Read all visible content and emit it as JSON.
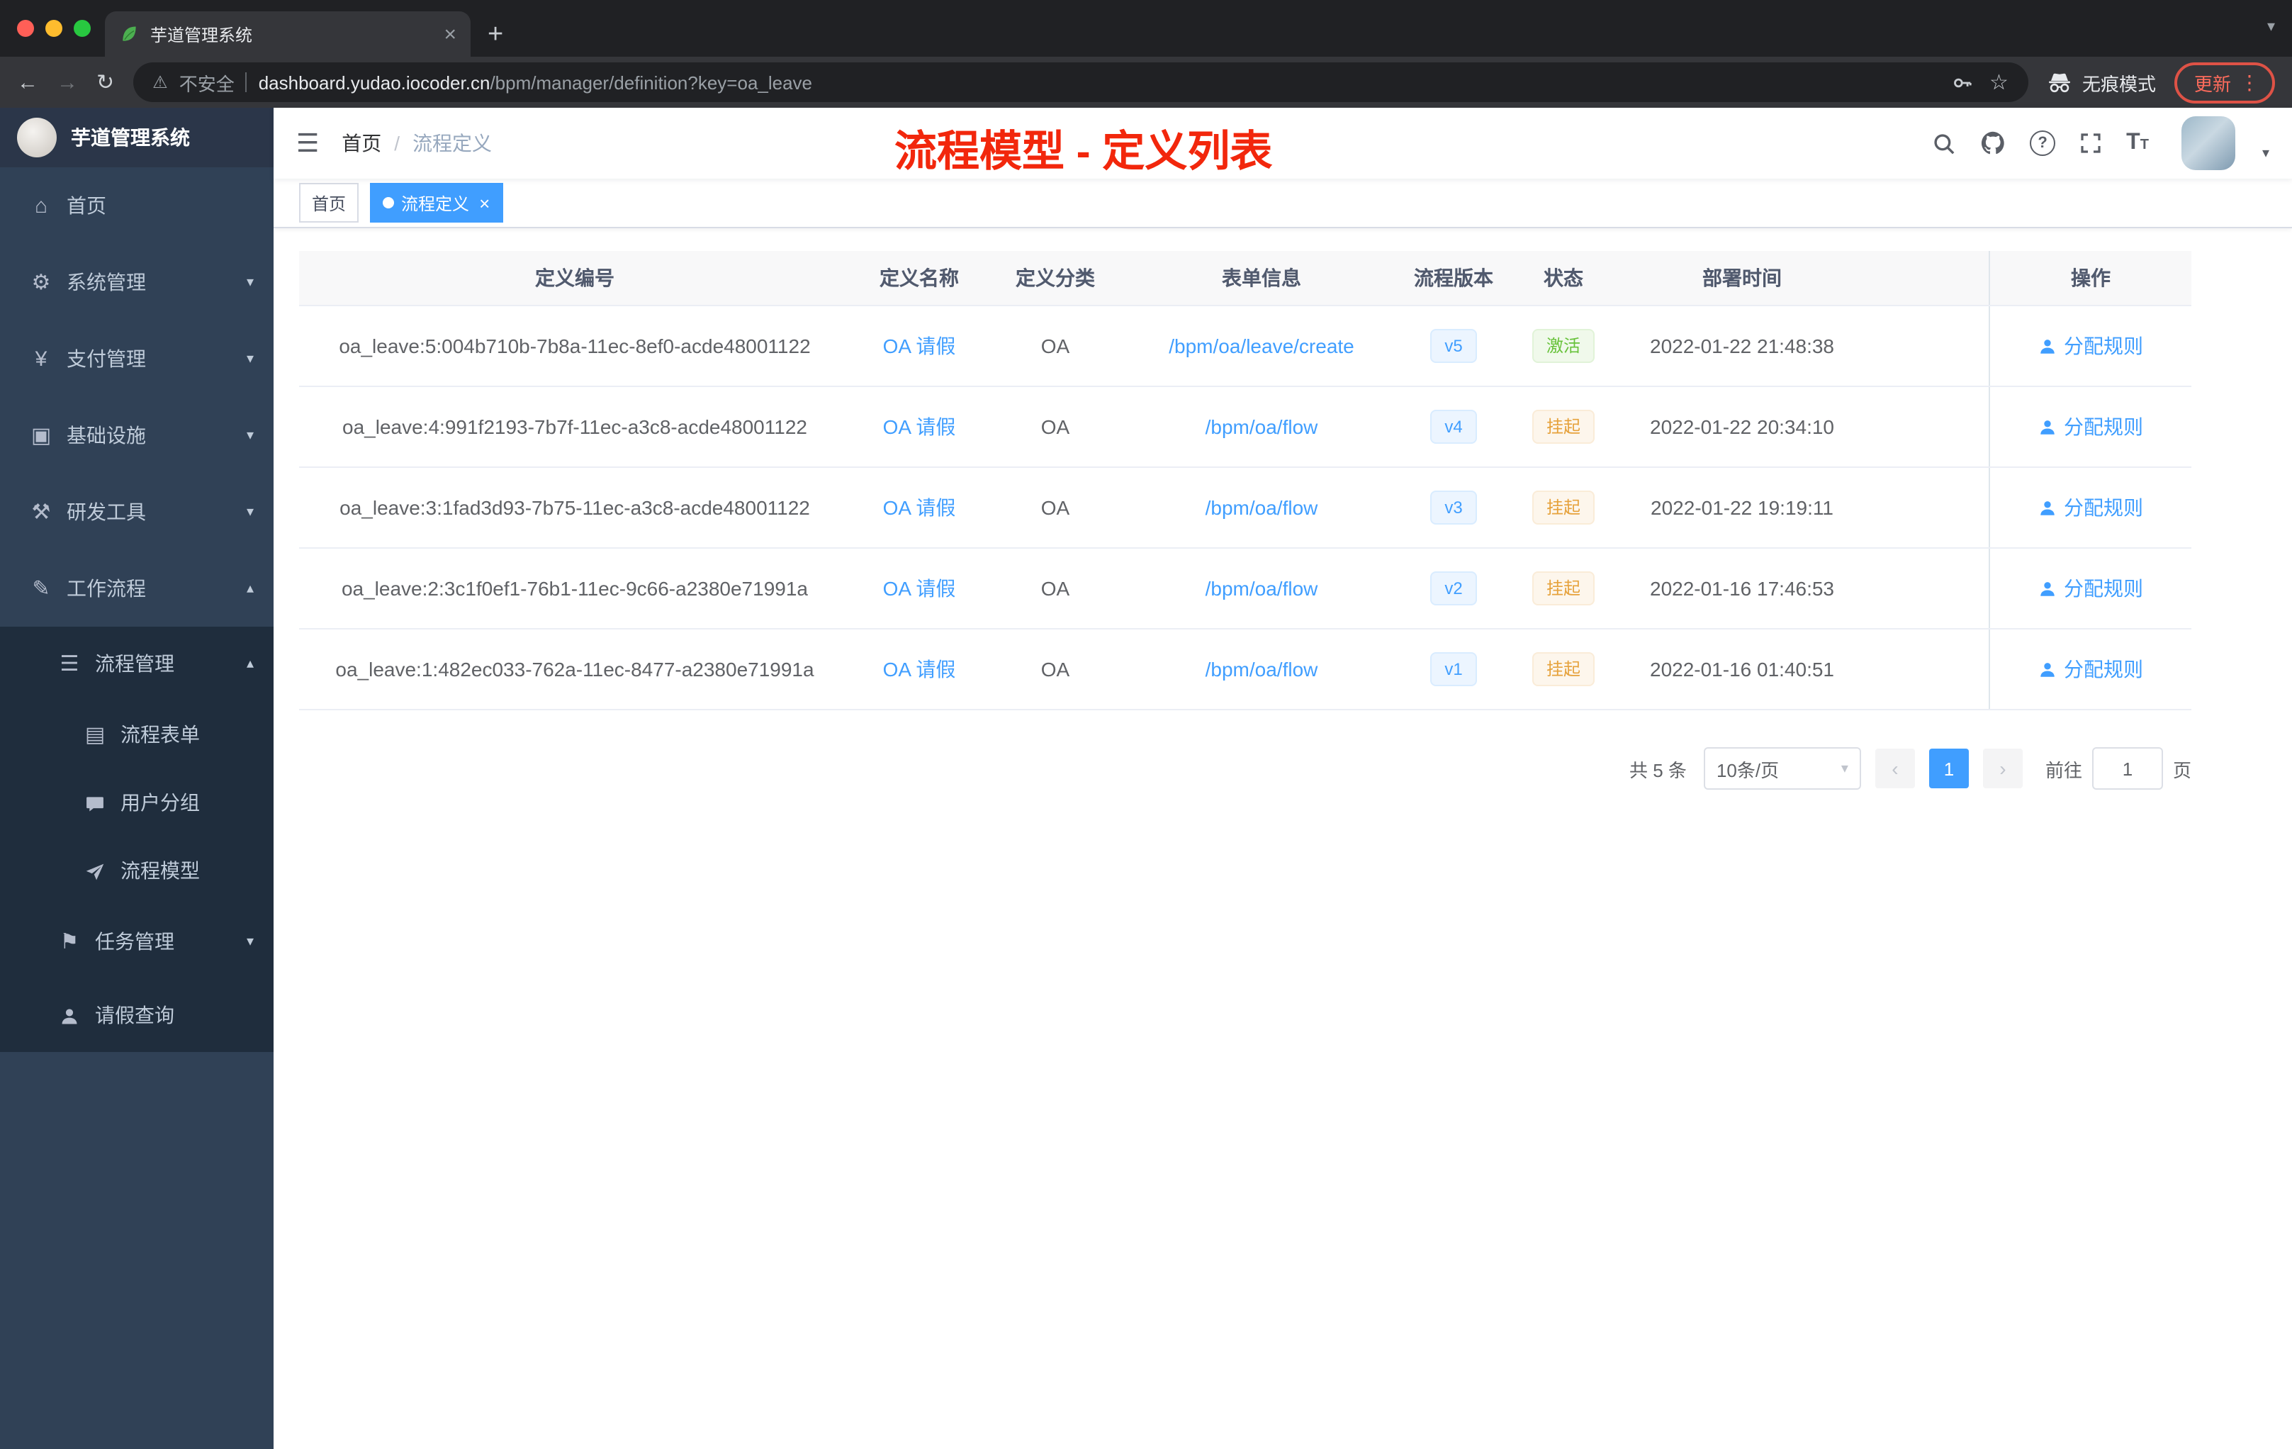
{
  "browser": {
    "tab_title": "芋道管理系统",
    "security_label": "不安全",
    "url_host": "dashboard.yudao.iocoder.cn",
    "url_path": "/bpm/manager/definition?key=oa_leave",
    "incognito_label": "无痕模式",
    "update_label": "更新"
  },
  "sidebar": {
    "logo_title": "芋道管理系统",
    "items": [
      {
        "label": "首页"
      },
      {
        "label": "系统管理"
      },
      {
        "label": "支付管理"
      },
      {
        "label": "基础设施"
      },
      {
        "label": "研发工具"
      },
      {
        "label": "工作流程"
      },
      {
        "label": "流程管理"
      },
      {
        "label": "流程表单"
      },
      {
        "label": "用户分组"
      },
      {
        "label": "流程模型"
      },
      {
        "label": "任务管理"
      },
      {
        "label": "请假查询"
      }
    ]
  },
  "header": {
    "breadcrumb_home": "首页",
    "breadcrumb_sep": "/",
    "breadcrumb_current": "流程定义",
    "annotation": "流程模型 - 定义列表"
  },
  "tags": {
    "home": "首页",
    "active": "流程定义"
  },
  "table": {
    "columns": [
      "定义编号",
      "定义名称",
      "定义分类",
      "表单信息",
      "流程版本",
      "状态",
      "部署时间",
      "操作"
    ],
    "rows": [
      {
        "id": "oa_leave:5:004b710b-7b8a-11ec-8ef0-acde48001122",
        "name": "OA 请假",
        "category": "OA",
        "form": "/bpm/oa/leave/create",
        "version": "v5",
        "status": "激活",
        "status_type": "success",
        "time": "2022-01-22 21:48:38",
        "action": "分配规则"
      },
      {
        "id": "oa_leave:4:991f2193-7b7f-11ec-a3c8-acde48001122",
        "name": "OA 请假",
        "category": "OA",
        "form": "/bpm/oa/flow",
        "version": "v4",
        "status": "挂起",
        "status_type": "warning",
        "time": "2022-01-22 20:34:10",
        "action": "分配规则"
      },
      {
        "id": "oa_leave:3:1fad3d93-7b75-11ec-a3c8-acde48001122",
        "name": "OA 请假",
        "category": "OA",
        "form": "/bpm/oa/flow",
        "version": "v3",
        "status": "挂起",
        "status_type": "warning",
        "time": "2022-01-22 19:19:11",
        "action": "分配规则"
      },
      {
        "id": "oa_leave:2:3c1f0ef1-76b1-11ec-9c66-a2380e71991a",
        "name": "OA 请假",
        "category": "OA",
        "form": "/bpm/oa/flow",
        "version": "v2",
        "status": "挂起",
        "status_type": "warning",
        "time": "2022-01-16 17:46:53",
        "action": "分配规则"
      },
      {
        "id": "oa_leave:1:482ec033-762a-11ec-8477-a2380e71991a",
        "name": "OA 请假",
        "category": "OA",
        "form": "/bpm/oa/flow",
        "version": "v1",
        "status": "挂起",
        "status_type": "warning",
        "time": "2022-01-16 01:40:51",
        "action": "分配规则"
      }
    ]
  },
  "pagination": {
    "total": "共 5 条",
    "page_size": "10条/页",
    "current_page": "1",
    "goto_label": "前往",
    "goto_value": "1",
    "goto_unit": "页"
  },
  "colors": {
    "accent_blue": "#409eff",
    "sidebar_bg": "#304156",
    "submenu_bg": "#1f2d3d",
    "annotation_red": "#f2270c",
    "status_active_green": "#67c23a",
    "status_suspend_orange": "#e6a23c"
  },
  "icons": {
    "back": "←",
    "forward": "→",
    "reload": "↻",
    "warning": "⚠",
    "star": "☆",
    "dots": "⋮",
    "caret_down": "▾",
    "caret_up": "▴",
    "close": "×",
    "plus": "+",
    "hamburger": "☰",
    "home": "⌂",
    "gear": "⚙",
    "yen": "¥",
    "monitor": "▣",
    "tools": "⚒",
    "workflow": "✎",
    "list": "☰",
    "doc": "▤",
    "flag": "⚑",
    "question": "?",
    "font_big": "T",
    "font_small": "T",
    "prev": "‹",
    "next": "›"
  }
}
